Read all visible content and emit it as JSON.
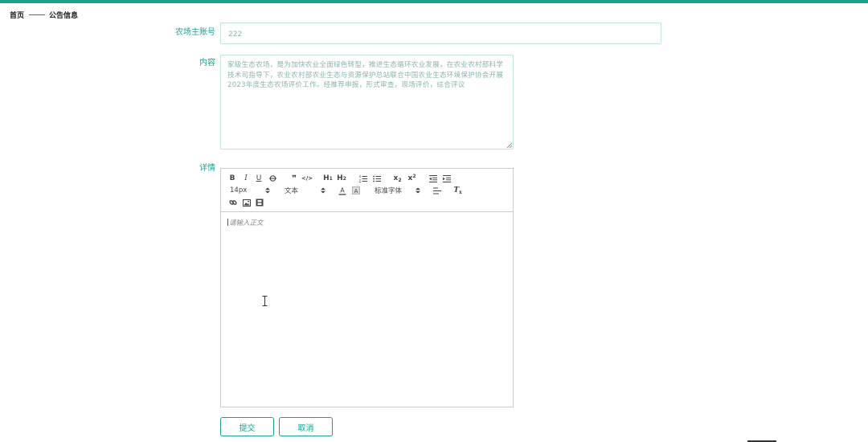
{
  "breadcrumb": {
    "home": "首页",
    "current": "公告信息"
  },
  "form": {
    "account_label": "农场主账号",
    "account_value": "222",
    "content_label": "内容",
    "content_value": "家级生态农场，是为加快农业全面绿色转型，推进生态循环农业发展，在农业农村部科学技术司指导下，农业农村部农业生态与资源保护总站联合中国农业生态环境保护协会开展2023年度生态农场评价工作。经推荐申报，形式审查，现场评价，综合评议",
    "detail_label": "详情"
  },
  "editor": {
    "toolbar_row1": [
      "B",
      "I",
      "U",
      "S",
      "99",
      "</>",
      "H1",
      "H2",
      "ordered-list-icon",
      "bullet-list-icon",
      "subscript-icon",
      "superscript-icon",
      "outdent-icon",
      "indent-icon"
    ],
    "font_size": "14px",
    "header_select": "文本",
    "font_family": "标准字体",
    "toolbar_row3": [
      "link-icon",
      "image-icon",
      "video-icon"
    ],
    "placeholder": "请输入正文"
  },
  "buttons": {
    "submit": "提交",
    "cancel": "取消"
  },
  "colors": {
    "accent": "#1aa290",
    "border": "#bfe3dd"
  }
}
